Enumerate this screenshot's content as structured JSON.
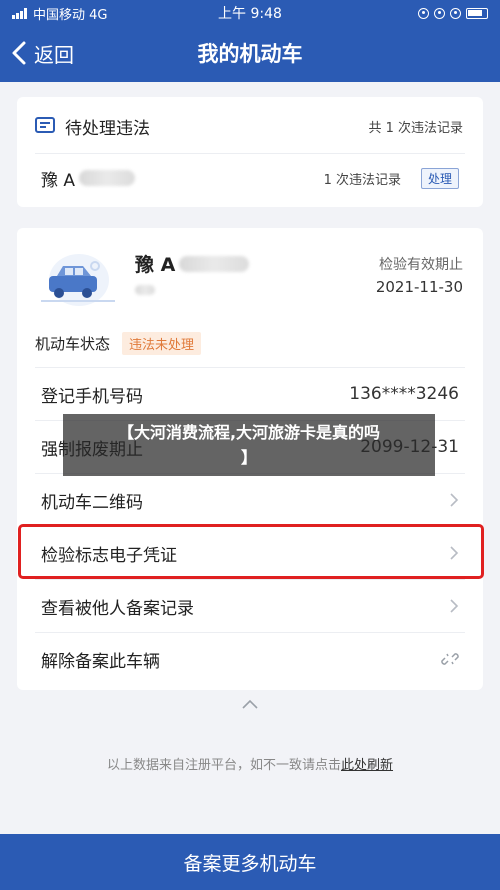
{
  "status_bar": {
    "carrier": "中国移动 4G",
    "time": "上午 9:48"
  },
  "nav": {
    "back_label": "返回",
    "title": "我的机动车"
  },
  "pending": {
    "title": "待处理违法",
    "summary": "共 1 次违法记录",
    "plate_prefix": "豫 A",
    "count_text": "1 次违法记录",
    "handle_label": "处理"
  },
  "vehicle": {
    "plate_prefix": "豫 A",
    "inspect_label": "检验有效期止",
    "inspect_date": "2021-11-30",
    "status_label": "机动车状态",
    "status_badge": "违法未处理"
  },
  "items": [
    {
      "label": "登记手机号码",
      "value": "136****3246"
    },
    {
      "label": "强制报废期止",
      "value": "2099-12-31"
    },
    {
      "label": "机动车二维码"
    },
    {
      "label": "检验标志电子凭证"
    },
    {
      "label": "查看被他人备案记录"
    },
    {
      "label": "解除备案此车辆"
    }
  ],
  "footer": {
    "note": "以上数据来自注册平台，如不一致请点击",
    "refresh_link": "此处刷新"
  },
  "bottom_button": "备案更多机动车",
  "overlay": {
    "line1": "【大河消费流程,大河旅游卡是真的吗",
    "line2": "】"
  },
  "colors": {
    "brand_blue": "#2b5bb4",
    "highlight_red": "#e02020",
    "badge_orange": "#e07a3a"
  },
  "icons": [
    "signal-icon",
    "chevron-left-icon",
    "list-icon",
    "car-icon",
    "chevron-right-icon",
    "unlink-icon",
    "chevron-up-icon"
  ]
}
